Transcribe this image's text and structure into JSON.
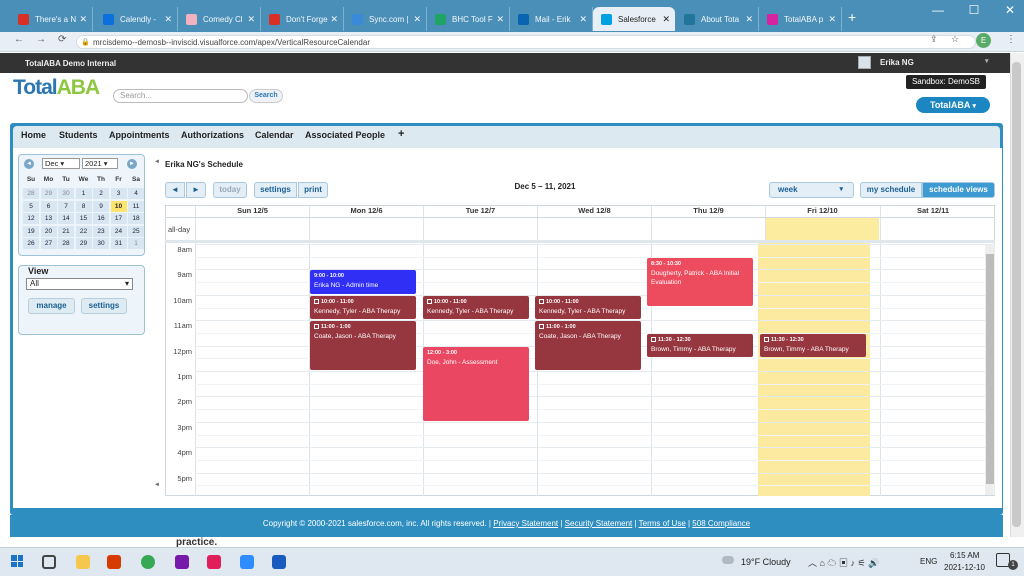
{
  "browser": {
    "tabs": [
      {
        "label": "There's a N",
        "color": "#d93025"
      },
      {
        "label": "Calendly -",
        "color": "#0b6fde"
      },
      {
        "label": "Comedy Cl",
        "color": "#f2b2c0"
      },
      {
        "label": "Don't Forge",
        "color": "#d93025"
      },
      {
        "label": "Sync.com |",
        "color": "#3b8ad9"
      },
      {
        "label": "BHC Tool F",
        "color": "#1fa463"
      },
      {
        "label": "Mail - Erik",
        "color": "#0a64b0"
      },
      {
        "label": "Salesforce",
        "color": "#00a1e0"
      },
      {
        "label": "About Tota",
        "color": "#21759b"
      },
      {
        "label": "TotalABA p",
        "color": "#d6249f"
      }
    ],
    "url": "mrcisdemo--demosb--inviscid.visualforce.com/apex/VerticalResourceCalendar",
    "profile_initial": "E"
  },
  "header": {
    "org_name": "TotalABA Demo Internal",
    "user_name": "Erika NG",
    "sandbox": "Sandbox: DemoSB",
    "search_placeholder": "Search...",
    "search_button": "Search",
    "app_menu": "TotalABA",
    "logo_main": "Total",
    "logo_accent": "ABA"
  },
  "nav": [
    "Home",
    "Students",
    "Appointments",
    "Authorizations",
    "Calendar",
    "Associated People",
    "+"
  ],
  "mini_calendar": {
    "month": "Dec",
    "year": "2021",
    "weekdays": [
      "Su",
      "Mo",
      "Tu",
      "We",
      "Th",
      "Fr",
      "Sa"
    ],
    "weeks": [
      [
        "28",
        "29",
        "30",
        "1",
        "2",
        "3",
        "4"
      ],
      [
        "5",
        "6",
        "7",
        "8",
        "9",
        "10",
        "11"
      ],
      [
        "12",
        "13",
        "14",
        "15",
        "16",
        "17",
        "18"
      ],
      [
        "19",
        "20",
        "21",
        "22",
        "23",
        "24",
        "25"
      ],
      [
        "26",
        "27",
        "28",
        "29",
        "30",
        "31",
        "1"
      ]
    ]
  },
  "view": {
    "label": "View",
    "selected": "All",
    "manage": "manage",
    "settings": "settings"
  },
  "calendar": {
    "schedule_title": "Erika NG's Schedule",
    "prev": "◄",
    "next": "►",
    "today": "today",
    "settings": "settings",
    "print": "print",
    "range": "Dec 5 – 11, 2021",
    "view_select": "week",
    "my_schedule": "my schedule",
    "schedule_views": "schedule views",
    "all_day": "all-day",
    "days": [
      "Sun 12/5",
      "Mon 12/6",
      "Tue 12/7",
      "Wed 12/8",
      "Thu 12/9",
      "Fri 12/10",
      "Sat 12/11"
    ],
    "times": [
      "8am",
      "9am",
      "10am",
      "11am",
      "12pm",
      "1pm",
      "2pm",
      "3pm",
      "4pm",
      "5pm"
    ],
    "events": [
      {
        "day": 1,
        "start": 9,
        "end": 10,
        "time": "9:00 - 10:00",
        "title": "Erika NG - Admin time",
        "color": "#2f2ff5",
        "icon": false
      },
      {
        "day": 1,
        "start": 10,
        "end": 11,
        "time": "10:00 - 11:00",
        "title": "Kennedy, Tyler - ABA Therapy",
        "color": "#96363f",
        "icon": true
      },
      {
        "day": 1,
        "start": 11,
        "end": 13,
        "time": "11:00 - 1:00",
        "title": "Coate, Jason - ABA Therapy",
        "color": "#96363f",
        "icon": true
      },
      {
        "day": 2,
        "start": 10,
        "end": 11,
        "time": "10:00 - 11:00",
        "title": "Kennedy, Tyler - ABA Therapy",
        "color": "#96363f",
        "icon": true
      },
      {
        "day": 2,
        "start": 12,
        "end": 15,
        "time": "12:00 - 3:00",
        "title": "Doe, John - Assessment",
        "color": "#ea4763",
        "icon": false
      },
      {
        "day": 3,
        "start": 10,
        "end": 11,
        "time": "10:00 - 11:00",
        "title": "Kennedy, Tyler - ABA Therapy",
        "color": "#96363f",
        "icon": true
      },
      {
        "day": 3,
        "start": 11,
        "end": 13,
        "time": "11:00 - 1:00",
        "title": "Coate, Jason - ABA Therapy",
        "color": "#96363f",
        "icon": true
      },
      {
        "day": 4,
        "start": 8.5,
        "end": 10.5,
        "time": "8:30 - 10:30",
        "title": "Dougherty, Patrick - ABA Initial Evaluation",
        "color": "#ec4c5e",
        "icon": false
      },
      {
        "day": 4,
        "start": 11.5,
        "end": 12.5,
        "time": "11:30 - 12:30",
        "title": "Brown, Timmy - ABA Therapy",
        "color": "#96363f",
        "icon": true
      },
      {
        "day": 5,
        "start": 11.5,
        "end": 12.5,
        "time": "11:30 - 12:30",
        "title": "Brown, Timmy - ABA Therapy",
        "color": "#96363f",
        "icon": true
      }
    ]
  },
  "footer": {
    "copyright": "Copyright © 2000-2021 salesforce.com, inc. All rights reserved.",
    "links": [
      "Privacy Statement",
      "Security Statement",
      "Terms of Use",
      "508 Compliance"
    ]
  },
  "taskbar": {
    "weather": "19°F Cloudy",
    "lang": "ENG",
    "time": "6:15 AM",
    "date": "2021-12-10",
    "notification_count": "1",
    "practice_text": "practice."
  }
}
